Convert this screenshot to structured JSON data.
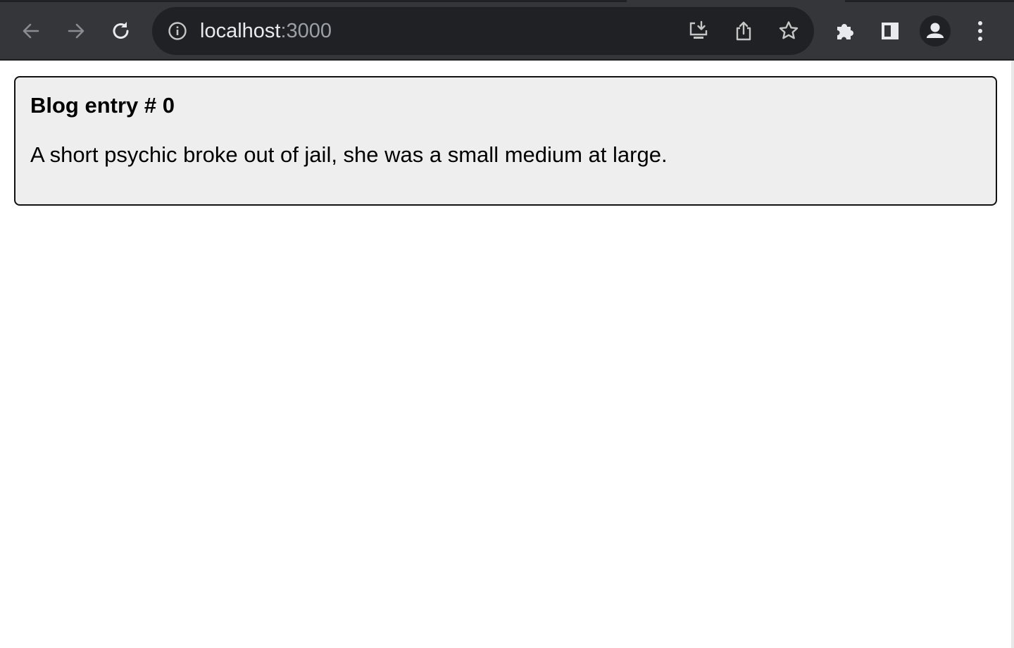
{
  "browser": {
    "url_host": "localhost",
    "url_port": ":3000",
    "icons": {
      "back": "arrow-left-icon",
      "forward": "arrow-right-icon",
      "reload": "reload-icon",
      "site_info": "info-circle-icon",
      "install": "install-app-icon",
      "share": "share-icon",
      "bookmark": "star-icon",
      "extensions": "puzzle-icon",
      "side_panel": "side-panel-icon",
      "profile": "profile-avatar-icon",
      "menu": "kebab-menu-icon"
    },
    "colors": {
      "toolbar": "#35363a",
      "omnibox": "#202124",
      "icon": "#e8eaed",
      "icon_dim": "#9aa0a6"
    }
  },
  "page": {
    "entries": [
      {
        "title": "Blog entry # 0",
        "body": "A short psychic broke out of jail, she was a small medium at large."
      }
    ],
    "colors": {
      "card_bg": "#eeeeee",
      "card_border": "#111111"
    }
  }
}
